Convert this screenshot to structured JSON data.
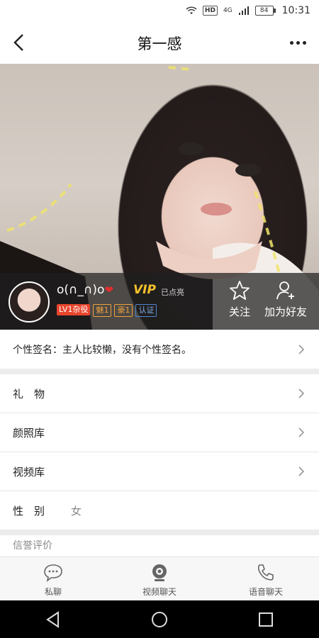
{
  "status_bar": {
    "network": "4G",
    "battery": "84",
    "time": "10:31"
  },
  "header": {
    "title": "第一感"
  },
  "profile": {
    "nickname": "o(∩_∩)o",
    "heart": "❤",
    "vip_label": "VIP",
    "vip_status": "已点亮",
    "badges": [
      {
        "text": "LV1杂役"
      },
      {
        "text": "魅1"
      },
      {
        "text": "豪1"
      },
      {
        "text": "认证"
      }
    ],
    "actions": {
      "follow": "关注",
      "add_friend": "加为好友"
    }
  },
  "signature": {
    "text": "个性签名：主人比较懒，没有个性签名。"
  },
  "menu": [
    {
      "label": "礼　物"
    },
    {
      "label": "颜照库"
    },
    {
      "label": "视频库"
    }
  ],
  "gender": {
    "label": "性　别",
    "value": "女"
  },
  "reputation": {
    "title": "信誉评价"
  },
  "tabbar": [
    {
      "label": "私聊",
      "icon": "chat-bubble-icon"
    },
    {
      "label": "视频聊天",
      "icon": "webcam-icon"
    },
    {
      "label": "语音聊天",
      "icon": "phone-icon"
    }
  ],
  "colors": {
    "vip": "#f3c12b",
    "heart": "#e0302e",
    "level_badge": "#e8452d",
    "badge_orange": "#f1a23b",
    "badge_blue": "#4f86d3"
  }
}
